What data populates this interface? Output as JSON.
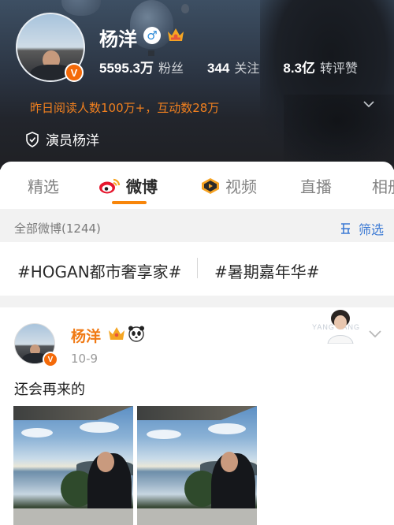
{
  "profile": {
    "name": "杨洋",
    "gender_icon": "male-icon",
    "followers_num": "5595.3万",
    "followers_label": "粉丝",
    "following_num": "344",
    "following_label": "关注",
    "engage_num": "8.3亿",
    "engage_label": "转评赞",
    "reads_summary": "昨日阅读人数100万+，互动数28万",
    "verification": "演员杨洋",
    "badge_letter": "V"
  },
  "tabs": [
    {
      "label": "精选"
    },
    {
      "label": "微博"
    },
    {
      "label": "视频"
    },
    {
      "label": "直播"
    },
    {
      "label": "相册"
    }
  ],
  "filter": {
    "count_text": "全部微博(1244)",
    "filter_label": "筛选"
  },
  "topics": [
    "#HOGAN都市奢享家#",
    "#暑期嘉年华#"
  ],
  "post": {
    "author": "杨洋",
    "date": "10-9",
    "text": "还会再来的",
    "sticker_text": "YANG YANG",
    "badge_letter": "V"
  },
  "colors": {
    "accent_orange": "#f07a15",
    "link_blue": "#3c7ad4",
    "verified_orange": "#f46a09"
  }
}
